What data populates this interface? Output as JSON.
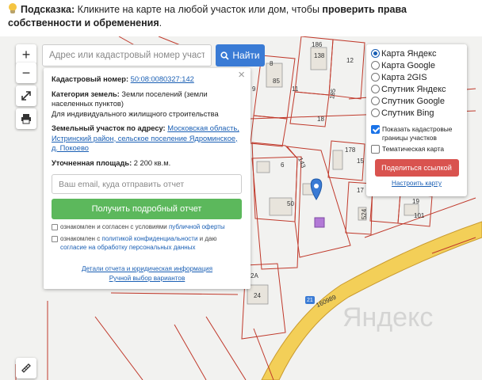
{
  "hint": {
    "label": "Подсказка:",
    "text": " Кликните на карте на любой участок или дом, чтобы ",
    "bold": "проверить права собственности и обременения",
    "end": "."
  },
  "map": {
    "plot_numbers": [
      "186",
      "138",
      "12",
      "8",
      "85",
      "9",
      "11",
      "185",
      "18",
      "178",
      "6",
      "143",
      "50",
      "15",
      "17",
      "19",
      "101",
      "524",
      "2A",
      "24",
      "21",
      "160989"
    ],
    "watermark": "Яндекс",
    "accent_colors": {
      "boundary": "#c0392b",
      "road": "#f0c040",
      "pin": "#3a7bd5"
    }
  },
  "search": {
    "placeholder": "Адрес или кадастровый номер участка",
    "button_label": "Найти",
    "icon": "search-icon"
  },
  "zoom": {
    "in": "+",
    "out": "−"
  },
  "info": {
    "cadastral_label": "Кадастровый номер:",
    "cadastral_value": "50:08:0080327:142",
    "category_label": "Категория земель:",
    "category_value": "Земли поселений (земли населенных пунктов)",
    "usage": "Для индивидуального жилищного строительства",
    "address_label": "Земельный участок по адресу:",
    "address_value": "Московская область, Истринский район, сельское поселение Ядроминское, д. Покоево",
    "area_label": "Уточненная площадь:",
    "area_value": "2 200 кв.м.",
    "email_placeholder": "Ваш email, куда отправить отчет",
    "report_button": "Получить подробный отчет",
    "consent1_text": "ознакомлен и согласен с условиями ",
    "consent1_link": "публичной оферты",
    "consent2_text": "ознакомлен с ",
    "consent2_link": "политикой конфиденциальности",
    "consent2_mid": " и даю ",
    "consent2_link2": "согласие на обработку персональных данных",
    "details_link": "Детали отчета и юридическая информация",
    "manual_link": "Ручной выбор вариантов",
    "close_label": "×"
  },
  "layers": {
    "options": [
      "Карта Яндекс",
      "Карта Google",
      "Карта 2GIS",
      "Спутник Яндекс",
      "Спутник Google",
      "Спутник Bing"
    ],
    "selected": 0,
    "show_borders": "Показать кадастровые границы участков",
    "show_borders_checked": true,
    "thematic": "Тематическая карта",
    "thematic_checked": false,
    "share_button": "Поделиться ссылкой",
    "tune_link": "Настроить карту"
  }
}
